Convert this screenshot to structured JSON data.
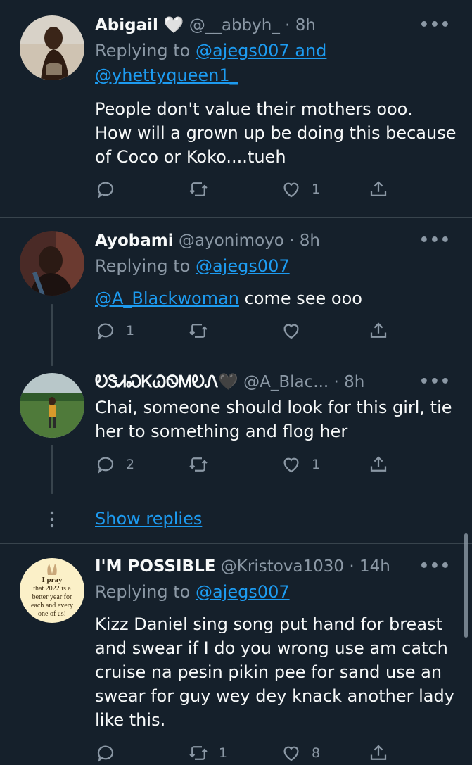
{
  "tweets": [
    {
      "name": "Abigail 🤍",
      "handle": "@__abbyh_",
      "time": "· 8h",
      "replying_prefix": "Replying to ",
      "replying_links": [
        "@ajegs007 and",
        "@yhettyqueen1_"
      ],
      "body_lines": [
        "People don't value their mothers ooo.",
        "How will a grown up be doing this because",
        "of Coco or Koko....tueh"
      ],
      "actions": {
        "reply": "",
        "retweet": "",
        "like": "1"
      }
    },
    {
      "name": "Ayobami",
      "handle": "@ayonimoyo",
      "time": "· 8h",
      "replying_prefix": "Replying to ",
      "replying_links": [
        "@ajegs007"
      ],
      "body_mention": "@A_Blackwoman",
      "body_rest": " come see ooo",
      "actions": {
        "reply": "1",
        "retweet": "",
        "like": ""
      }
    },
    {
      "name": "ᎧᏕᏗᏍᏦᏇᏫᎷᎧᏁ🖤",
      "handle": "@A_Blac...",
      "time": "· 8h",
      "body_lines": [
        "Chai, someone should look for this girl, tie",
        "her to something and flog her"
      ],
      "actions": {
        "reply": "2",
        "retweet": "",
        "like": "1"
      }
    },
    {
      "name": "I'M POSSIBLE",
      "handle": "@Kristova1030",
      "time": "· 14h",
      "replying_prefix": "Replying to ",
      "replying_links": [
        "@ajegs007"
      ],
      "avatar_text": [
        "I pray",
        "that 2022 is a",
        "better year for",
        "each and every",
        "one of us!"
      ],
      "body_lines": [
        "Kizz Daniel sing song put hand for breast",
        "and swear if I do you wrong use am catch",
        "cruise na pesin pikin pee for sand use an",
        "swear for guy wey dey knack another lady",
        "like this."
      ],
      "actions": {
        "reply": "",
        "retweet": "1",
        "like": "8"
      }
    }
  ],
  "show_replies": "Show replies",
  "more_glyph": "•••",
  "colors": {
    "background": "#15202b",
    "link": "#1d9bf0",
    "muted": "#8b98a5",
    "divider": "#38444d"
  }
}
